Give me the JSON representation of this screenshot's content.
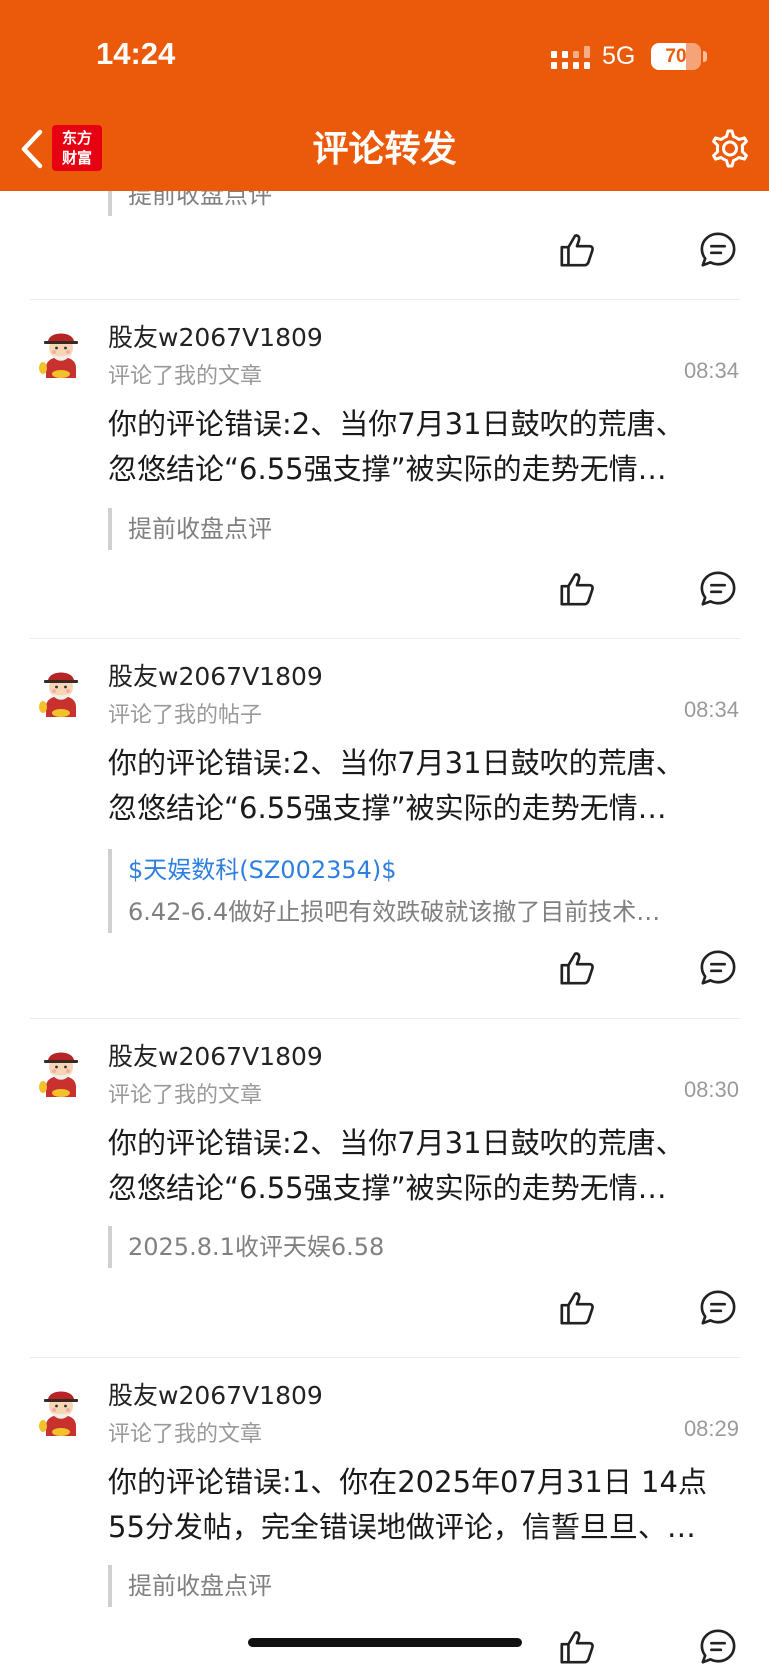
{
  "status_bar": {
    "time": "14:24",
    "network": "5G",
    "battery": "70",
    "battery_level": 0.7
  },
  "header": {
    "title": "评论转发",
    "logo_line1": "东方",
    "logo_line2": "财富"
  },
  "colors": {
    "accent": "#eb5a0a",
    "link": "#2f7fe0",
    "muted": "#9a9a9a"
  },
  "items": [
    {
      "quote": "提前收盘点评"
    },
    {
      "username": "股友w2067V1809",
      "action": "评论了我的文章",
      "time": "08:34",
      "content_line1": "你的评论错误:2、当你7月31日鼓吹的荒唐、",
      "content_line2": "忽悠结论“6.55强支撑”被实际的走势无情…",
      "quote": "提前收盘点评"
    },
    {
      "username": "股友w2067V1809",
      "action": "评论了我的帖子",
      "time": "08:34",
      "content_line1": "你的评论错误:2、当你7月31日鼓吹的荒唐、",
      "content_line2": "忽悠结论“6.55强支撑”被实际的走势无情…",
      "quote_link": "$天娱数科(SZ002354)$",
      "quote": "6.42-6.4做好止损吧有效跌破就该撤了目前技术…"
    },
    {
      "username": "股友w2067V1809",
      "action": "评论了我的文章",
      "time": "08:30",
      "content_line1": "你的评论错误:2、当你7月31日鼓吹的荒唐、",
      "content_line2": "忽悠结论“6.55强支撑”被实际的走势无情…",
      "quote": "2025.8.1收评天娱6.58"
    },
    {
      "username": "股友w2067V1809",
      "action": "评论了我的文章",
      "time": "08:29",
      "content_line1": "你的评论错误:1、你在2025年07月31日 14点",
      "content_line2": "55分发帖，完全错误地做评论，信誓旦旦、…",
      "quote": "提前收盘点评"
    }
  ]
}
